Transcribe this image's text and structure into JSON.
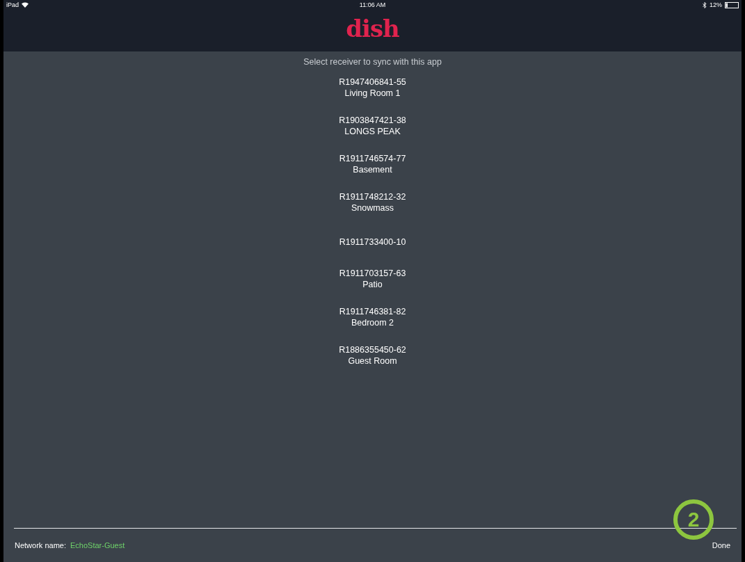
{
  "status_bar": {
    "device": "iPad",
    "time": "11:06 AM",
    "battery": "12%"
  },
  "logo": "dish",
  "prompt": "Select receiver to sync with this app",
  "receivers": [
    {
      "id": "R1947406841-55",
      "name": "Living Room 1"
    },
    {
      "id": "R1903847421-38",
      "name": "LONGS PEAK"
    },
    {
      "id": "R1911746574-77",
      "name": "Basement"
    },
    {
      "id": "R1911748212-32",
      "name": "Snowmass"
    },
    {
      "id": "R1911733400-10"
    },
    {
      "id": "R1911703157-63",
      "name": "Patio"
    },
    {
      "id": "R1911746381-82",
      "name": "Bedroom 2"
    },
    {
      "id": "R1886355450-62",
      "name": "Guest Room"
    }
  ],
  "footer": {
    "network_label": "Network name:",
    "network_name": "EchoStar-Guest",
    "done": "Done"
  },
  "callout": "2"
}
